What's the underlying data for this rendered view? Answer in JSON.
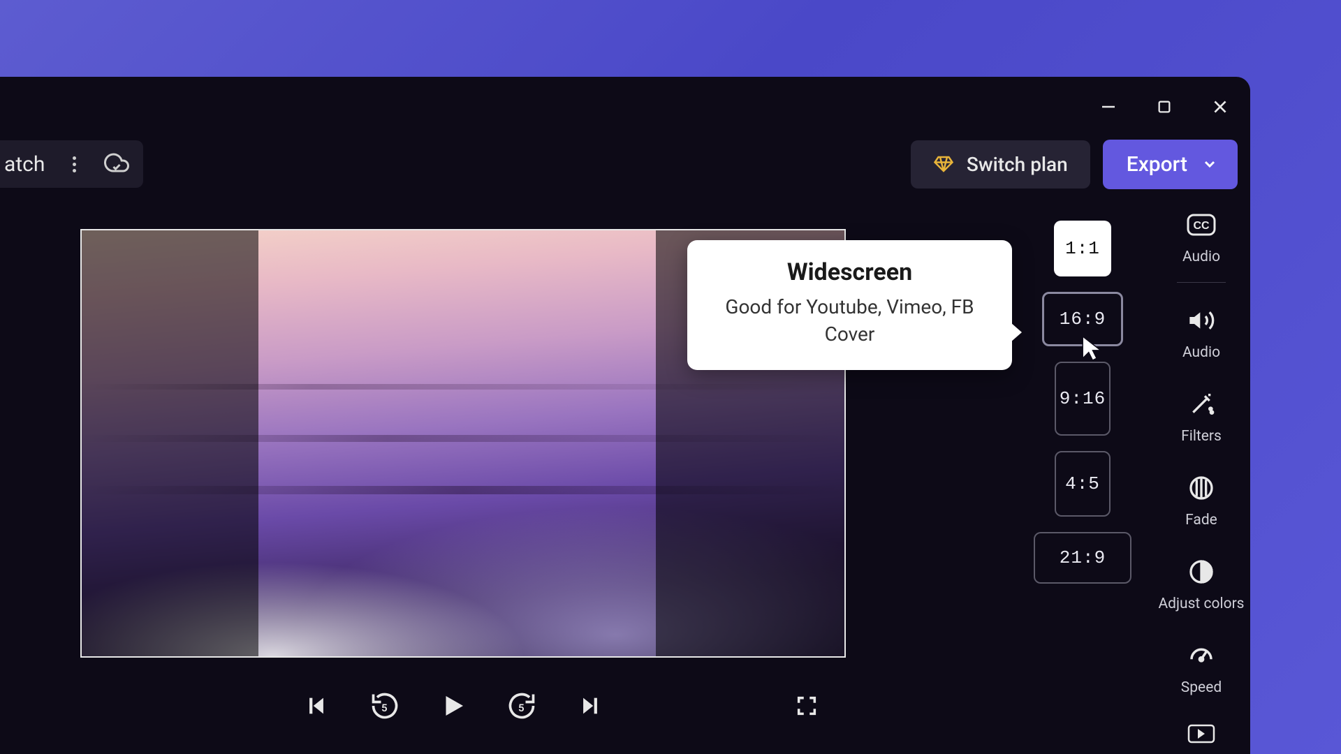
{
  "window": {
    "title_fragment": "atch"
  },
  "topbar": {
    "switch_plan": "Switch plan",
    "export": "Export"
  },
  "rail": {
    "audio_cc": "Audio",
    "audio": "Audio",
    "filters": "Filters",
    "fade": "Fade",
    "adjust_colors": "Adjust colors",
    "speed": "Speed"
  },
  "playback": {
    "rewind_seconds": "5",
    "forward_seconds": "5"
  },
  "ratios": {
    "square": "1:1",
    "widescreen": "16:9",
    "vertical": "9:16",
    "fourfive": "4:5",
    "ultrawide": "21:9"
  },
  "tooltip": {
    "title": "Widescreen",
    "body": "Good for Youtube, Vimeo, FB Cover"
  }
}
